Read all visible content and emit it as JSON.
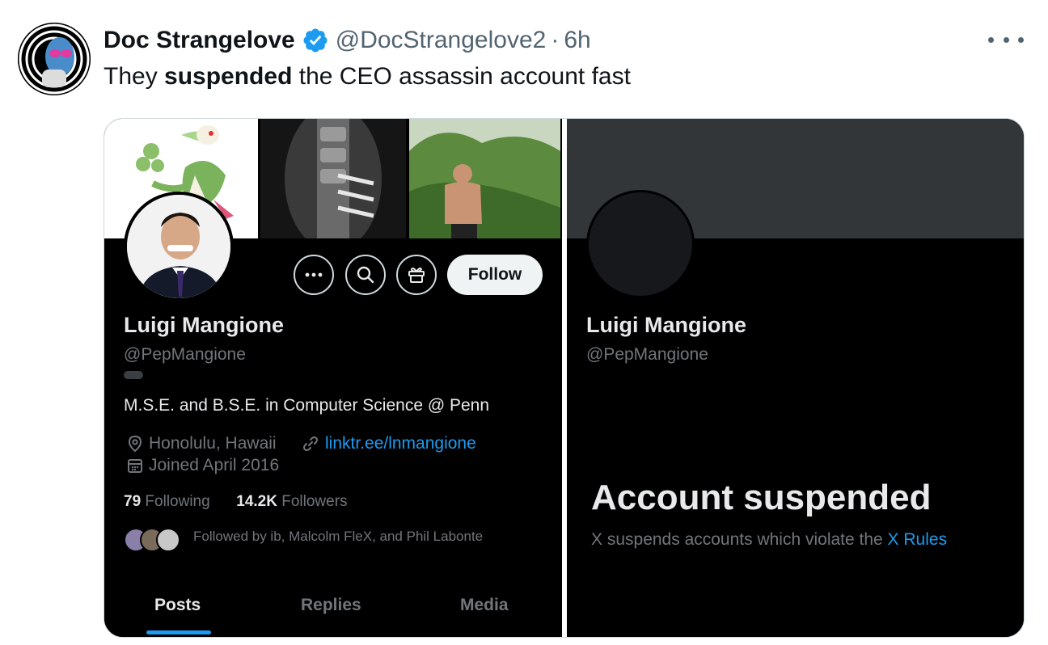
{
  "tweet": {
    "author_name": "Doc Strangelove",
    "handle": "@DocStrangelove2",
    "separator": "·",
    "time": "6h",
    "text_before": "They ",
    "text_bold": "suspended",
    "text_after": " the CEO assassin account fast",
    "verified_icon": "verified-badge-icon",
    "more_icon": "more-options-icon"
  },
  "left_profile": {
    "name": "Luigi Mangione",
    "handle": "@PepMangione",
    "bio": "M.S.E. and B.S.E. in Computer Science @ Penn",
    "location": "Honolulu, Hawaii",
    "website": "linktr.ee/lnmangione",
    "joined": "Joined April 2016",
    "following_count": "79",
    "following_label": "Following",
    "followers_count": "14.2K",
    "followers_label": "Followers",
    "followed_by": "Followed by ib, Malcolm FleX, and Phil Labonte",
    "follow_label": "Follow",
    "tabs": [
      "Posts",
      "Replies",
      "Media"
    ],
    "active_tab": "Posts"
  },
  "right_profile": {
    "name": "Luigi Mangione",
    "handle": "@PepMangione",
    "suspended_title": "Account suspended",
    "suspended_text": "X suspends accounts which violate the ",
    "rules_link": "X Rules"
  },
  "colors": {
    "link_blue": "#1d9bf0",
    "verified_blue": "#1d9bf0",
    "dark_bg": "#000000",
    "muted_text": "#71767b"
  }
}
